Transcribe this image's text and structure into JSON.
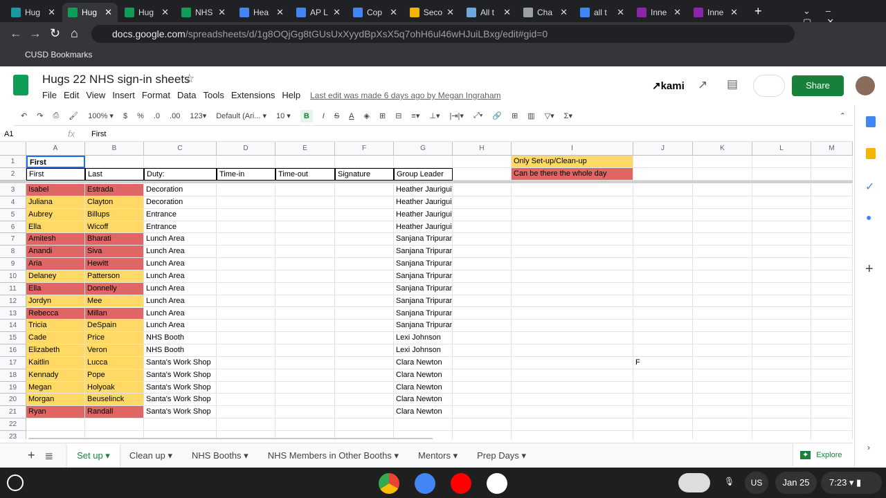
{
  "browser": {
    "tabs": [
      "Hug",
      "Hug",
      "Hug",
      "NHS",
      "Hea",
      "AP L",
      "Cop",
      "Seco",
      "All t",
      "Cha",
      "all t",
      "Inne",
      "Inne"
    ],
    "tab_colors": [
      "#1a9aa0",
      "#0f9d58",
      "#0f9d58",
      "#0f9d58",
      "#4285f4",
      "#4285f4",
      "#4285f4",
      "#f4b400",
      "#6fa8dc",
      "#9aa0a6",
      "#4285f4",
      "#8e24aa",
      "#8e24aa"
    ],
    "url_host": "docs.google.com",
    "url_path": "/spreadsheets/d/1g8OQjGg8tGUsUxXyydBpXsX5q7ohH6ul46wHJuiLBxg/edit#gid=0",
    "bookmark": "CUSD Bookmarks"
  },
  "doc": {
    "title": "Hugs 22 NHS sign-in sheets",
    "menus": [
      "File",
      "Edit",
      "View",
      "Insert",
      "Format",
      "Data",
      "Tools",
      "Extensions",
      "Help"
    ],
    "last_edit": "Last edit was made 6 days ago by Megan Ingraham",
    "share": "Share",
    "kami": "kami"
  },
  "toolbar": {
    "zoom": "100%",
    "currency": "$",
    "percent": "%",
    "dec_less": ".0",
    "dec_more": ".00",
    "format": "123",
    "font": "Default (Ari...",
    "size": "10"
  },
  "formula": {
    "ref": "A1",
    "fx": "fx",
    "value": "First"
  },
  "columns": [
    "A",
    "B",
    "C",
    "D",
    "E",
    "F",
    "G",
    "H",
    "I",
    "J",
    "K",
    "L",
    "M"
  ],
  "row1": {
    "A": "First",
    "I": "Only Set-up/Clean-up"
  },
  "row2": {
    "A": "First",
    "B": "Last",
    "C": "Duty:",
    "D": "Time-in",
    "E": "Time-out",
    "F": "Signature",
    "G": "Group Leader",
    "I": "Can be there the whole day"
  },
  "colors": {
    "red": "#e06666",
    "yellow": "#ffd966"
  },
  "rows": [
    [
      "Isabel",
      "Estrada",
      "Decoration",
      "Heather Jaurigui",
      "red"
    ],
    [
      "Juliana",
      "Clayton",
      "Decoration",
      "Heather Jaurigui",
      "yellow"
    ],
    [
      "Aubrey",
      "Billups",
      "Entrance",
      "Heather Jaurigui",
      "yellow"
    ],
    [
      "Ella",
      "Wicoff",
      "Entrance",
      "Heather Jaurigui",
      "yellow"
    ],
    [
      "Amitesh",
      "Bharati",
      "Lunch Area",
      "Sanjana Tripuraneni",
      "red"
    ],
    [
      "Anandi",
      "Siva",
      "Lunch Area",
      "Sanjana Tripuraneni",
      "red"
    ],
    [
      "Aria",
      "Hewitt",
      "Lunch Area",
      "Sanjana Tripuraneni",
      "red"
    ],
    [
      "Delaney",
      "Patterson",
      "Lunch Area",
      "Sanjana Tripuraneni",
      "yellow"
    ],
    [
      "Ella",
      "Donnelly",
      "Lunch Area",
      "Sanjana Tripuraneni",
      "red"
    ],
    [
      "Jordyn",
      "Mee",
      "Lunch Area",
      "Sanjana Tripuraneni",
      "yellow"
    ],
    [
      "Rebecca",
      "Millan",
      "Lunch Area",
      "Sanjana Tripuraneni",
      "red"
    ],
    [
      "Tricia",
      "DeSpain",
      "Lunch Area",
      "Sanjana Tripuraneni",
      "yellow"
    ],
    [
      "Cade",
      "Price",
      "NHS Booth",
      "Lexi Johnson",
      "yellow"
    ],
    [
      "Elizabeth",
      "Veron",
      "NHS Booth",
      "Lexi Johnson",
      "yellow"
    ],
    [
      "Kaitlin",
      "Lucca",
      "Santa's Work Shop",
      "Clara Newton",
      "yellow"
    ],
    [
      "Kennady",
      "Pope",
      "Santa's Work Shop",
      "Clara Newton",
      "yellow"
    ],
    [
      "Megan",
      "Holyoak",
      "Santa's Work Shop",
      "Clara Newton",
      "yellow"
    ],
    [
      "Morgan",
      "Beuselinck",
      "Santa's Work Shop",
      "Clara Newton",
      "yellow"
    ],
    [
      "Ryan",
      "Randall",
      "Santa's Work Shop",
      "Clara Newton",
      "red"
    ]
  ],
  "row17_J": "F",
  "sheets": [
    "Set up",
    "Clean up",
    "NHS Booths",
    "NHS Members in Other Booths",
    "Mentors",
    "Prep Days"
  ],
  "explore": "Explore",
  "shelf": {
    "date": "Jan 25",
    "time": "7:23",
    "ime": "US"
  }
}
